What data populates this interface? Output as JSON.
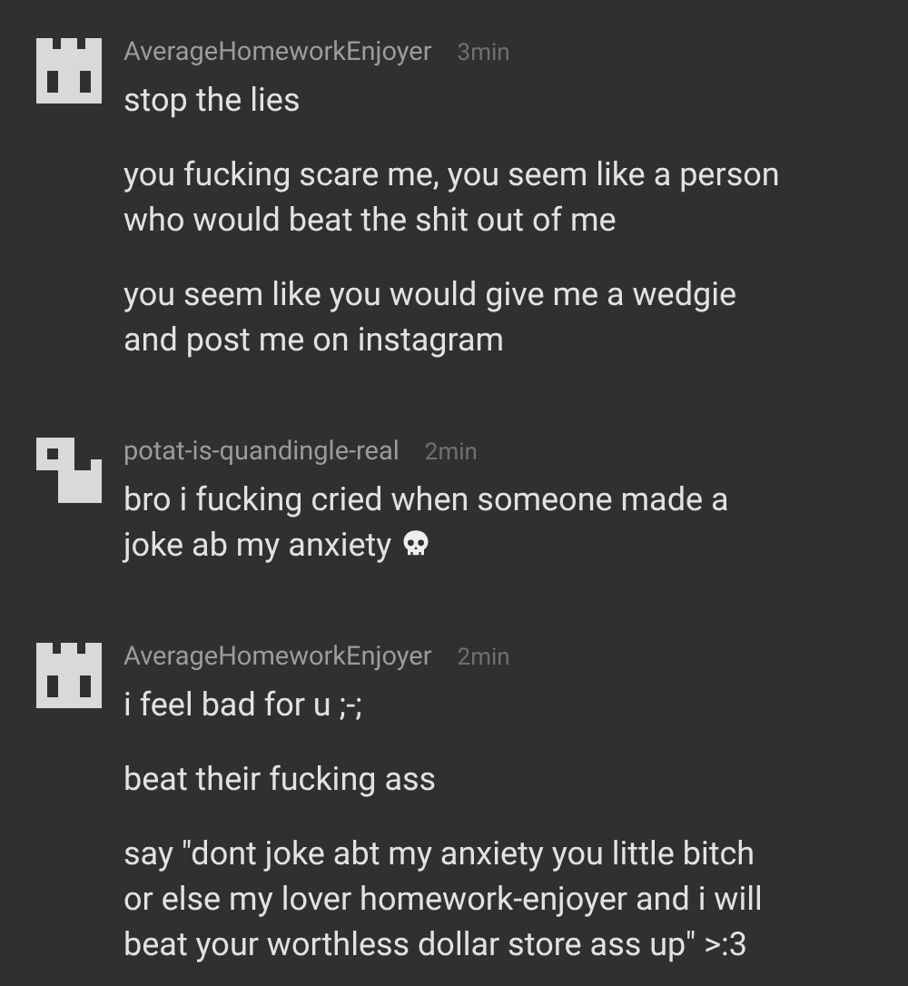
{
  "messages": [
    {
      "author": "AverageHomeworkEnjoyer",
      "time": "3min",
      "avatar": {
        "kind": "castle"
      },
      "lines": [
        {
          "text": "stop the lies",
          "emoji": false
        },
        {
          "text": "you fucking scare me, you seem like a person who would beat the shit out of me",
          "emoji": false
        },
        {
          "text": "you seem like you would give me a wedgie and post me on instagram",
          "emoji": false
        }
      ]
    },
    {
      "author": "potat-is-quandingle-real",
      "time": "2min",
      "avatar": {
        "kind": "hook"
      },
      "lines": [
        {
          "text": "bro i fucking cried when someone made a joke ab my anxiety",
          "emoji": true
        }
      ]
    },
    {
      "author": "AverageHomeworkEnjoyer",
      "time": "2min",
      "avatar": {
        "kind": "castle"
      },
      "lines": [
        {
          "text": "i feel bad for u ;-;",
          "emoji": false
        },
        {
          "text": "beat their fucking ass",
          "emoji": false
        },
        {
          "text": "say \"dont joke abt my anxiety you little bitch or else my lover homework-enjoyer and i will beat your worthless dollar store ass up\" >:3",
          "emoji": false
        }
      ]
    }
  ]
}
